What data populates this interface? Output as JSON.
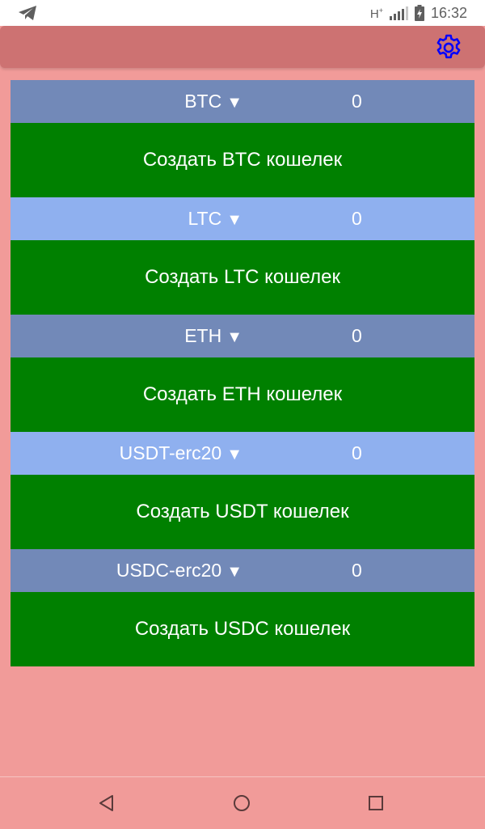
{
  "status_bar": {
    "network_type": "H",
    "network_sup": "+",
    "time": "16:32"
  },
  "app_bar": {
    "settings_icon": "gear-icon",
    "settings_color": "#0000ff"
  },
  "wallets": [
    {
      "currency": "BTC",
      "arrow": "▼",
      "balance": "0",
      "create_label": "Создать BTC кошелек"
    },
    {
      "currency": "LTC",
      "arrow": "▼",
      "balance": "0",
      "create_label": "Создать LTC кошелек"
    },
    {
      "currency": "ETH",
      "arrow": "▼",
      "balance": "0",
      "create_label": "Создать ETH кошелек"
    },
    {
      "currency": "USDT-erc20",
      "arrow": "▼",
      "balance": "0",
      "create_label": "Создать USDT кошелек"
    },
    {
      "currency": "USDC-erc20",
      "arrow": "▼",
      "balance": "0",
      "create_label": "Создать USDC кошелек"
    }
  ],
  "colors": {
    "background": "#f19b99",
    "app_bar": "#cd7272",
    "header_dark": "#7289b8",
    "header_light": "#8fb0ef",
    "create_button": "#008000"
  },
  "nav_bar": {
    "back_icon": "back-triangle-icon",
    "home_icon": "home-circle-icon",
    "recents_icon": "recents-square-icon"
  }
}
